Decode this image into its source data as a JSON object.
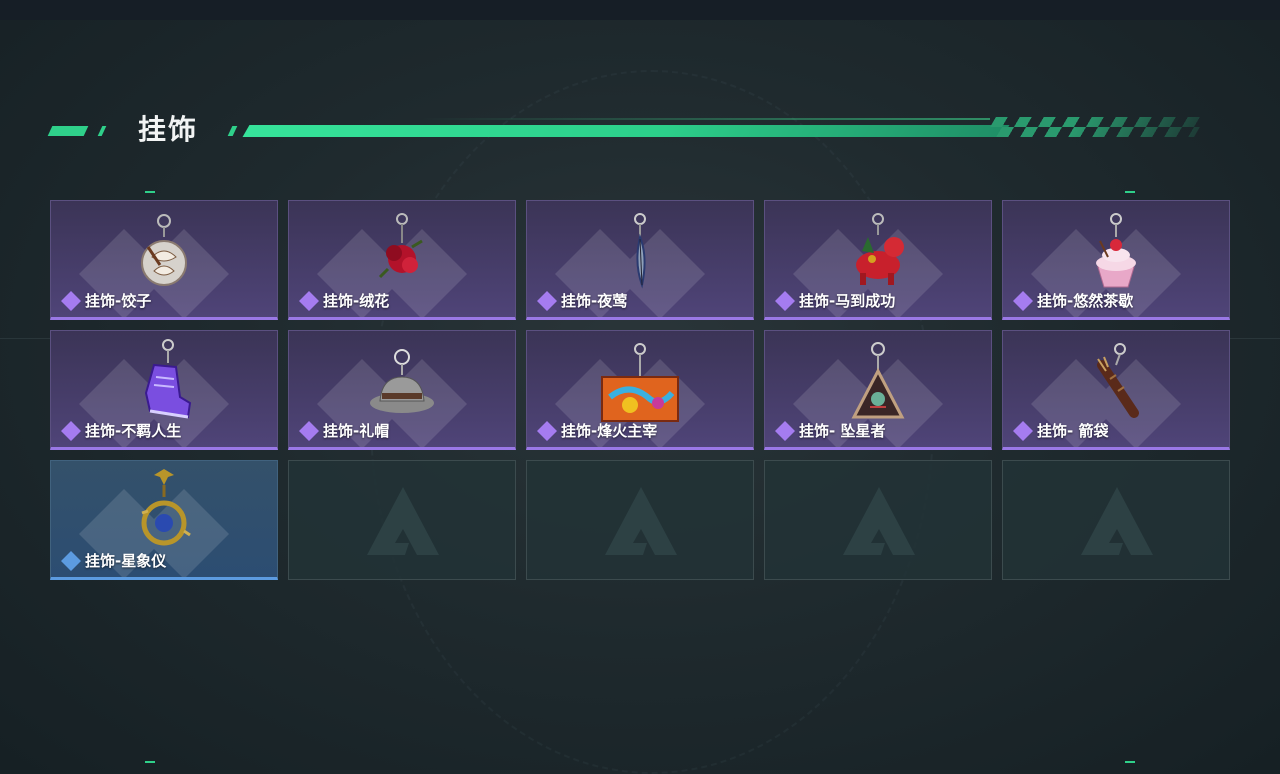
{
  "page": {
    "title": "挂饰"
  },
  "colors": {
    "accent": "#2fd08a",
    "purple_rarity": "#9a78e6",
    "blue_rarity": "#5c9be0"
  },
  "items": [
    {
      "name": "挂饰-饺子",
      "rarity": "purple",
      "icon": "dumpling-charm-icon"
    },
    {
      "name": "挂饰-绒花",
      "rarity": "purple",
      "icon": "velvet-flower-charm-icon"
    },
    {
      "name": "挂饰-夜莺",
      "rarity": "purple",
      "icon": "nightingale-feather-charm-icon"
    },
    {
      "name": "挂饰-马到成功",
      "rarity": "purple",
      "icon": "red-horse-charm-icon"
    },
    {
      "name": "挂饰-悠然茶歇",
      "rarity": "purple",
      "icon": "cupcake-charm-icon"
    },
    {
      "name": "挂饰-不羁人生",
      "rarity": "purple",
      "icon": "sneaker-charm-icon"
    },
    {
      "name": "挂饰-礼帽",
      "rarity": "purple",
      "icon": "fedora-hat-charm-icon"
    },
    {
      "name": "挂饰-烽火主宰",
      "rarity": "purple",
      "icon": "graffiti-box-charm-icon"
    },
    {
      "name": "挂饰- 坠星者",
      "rarity": "purple",
      "icon": "triangle-emblem-charm-icon"
    },
    {
      "name": "挂饰- 箭袋",
      "rarity": "purple",
      "icon": "quiver-charm-icon"
    },
    {
      "name": "挂饰-星象仪",
      "rarity": "blue",
      "icon": "astrolabe-charm-icon"
    }
  ],
  "empty_slots": 4
}
